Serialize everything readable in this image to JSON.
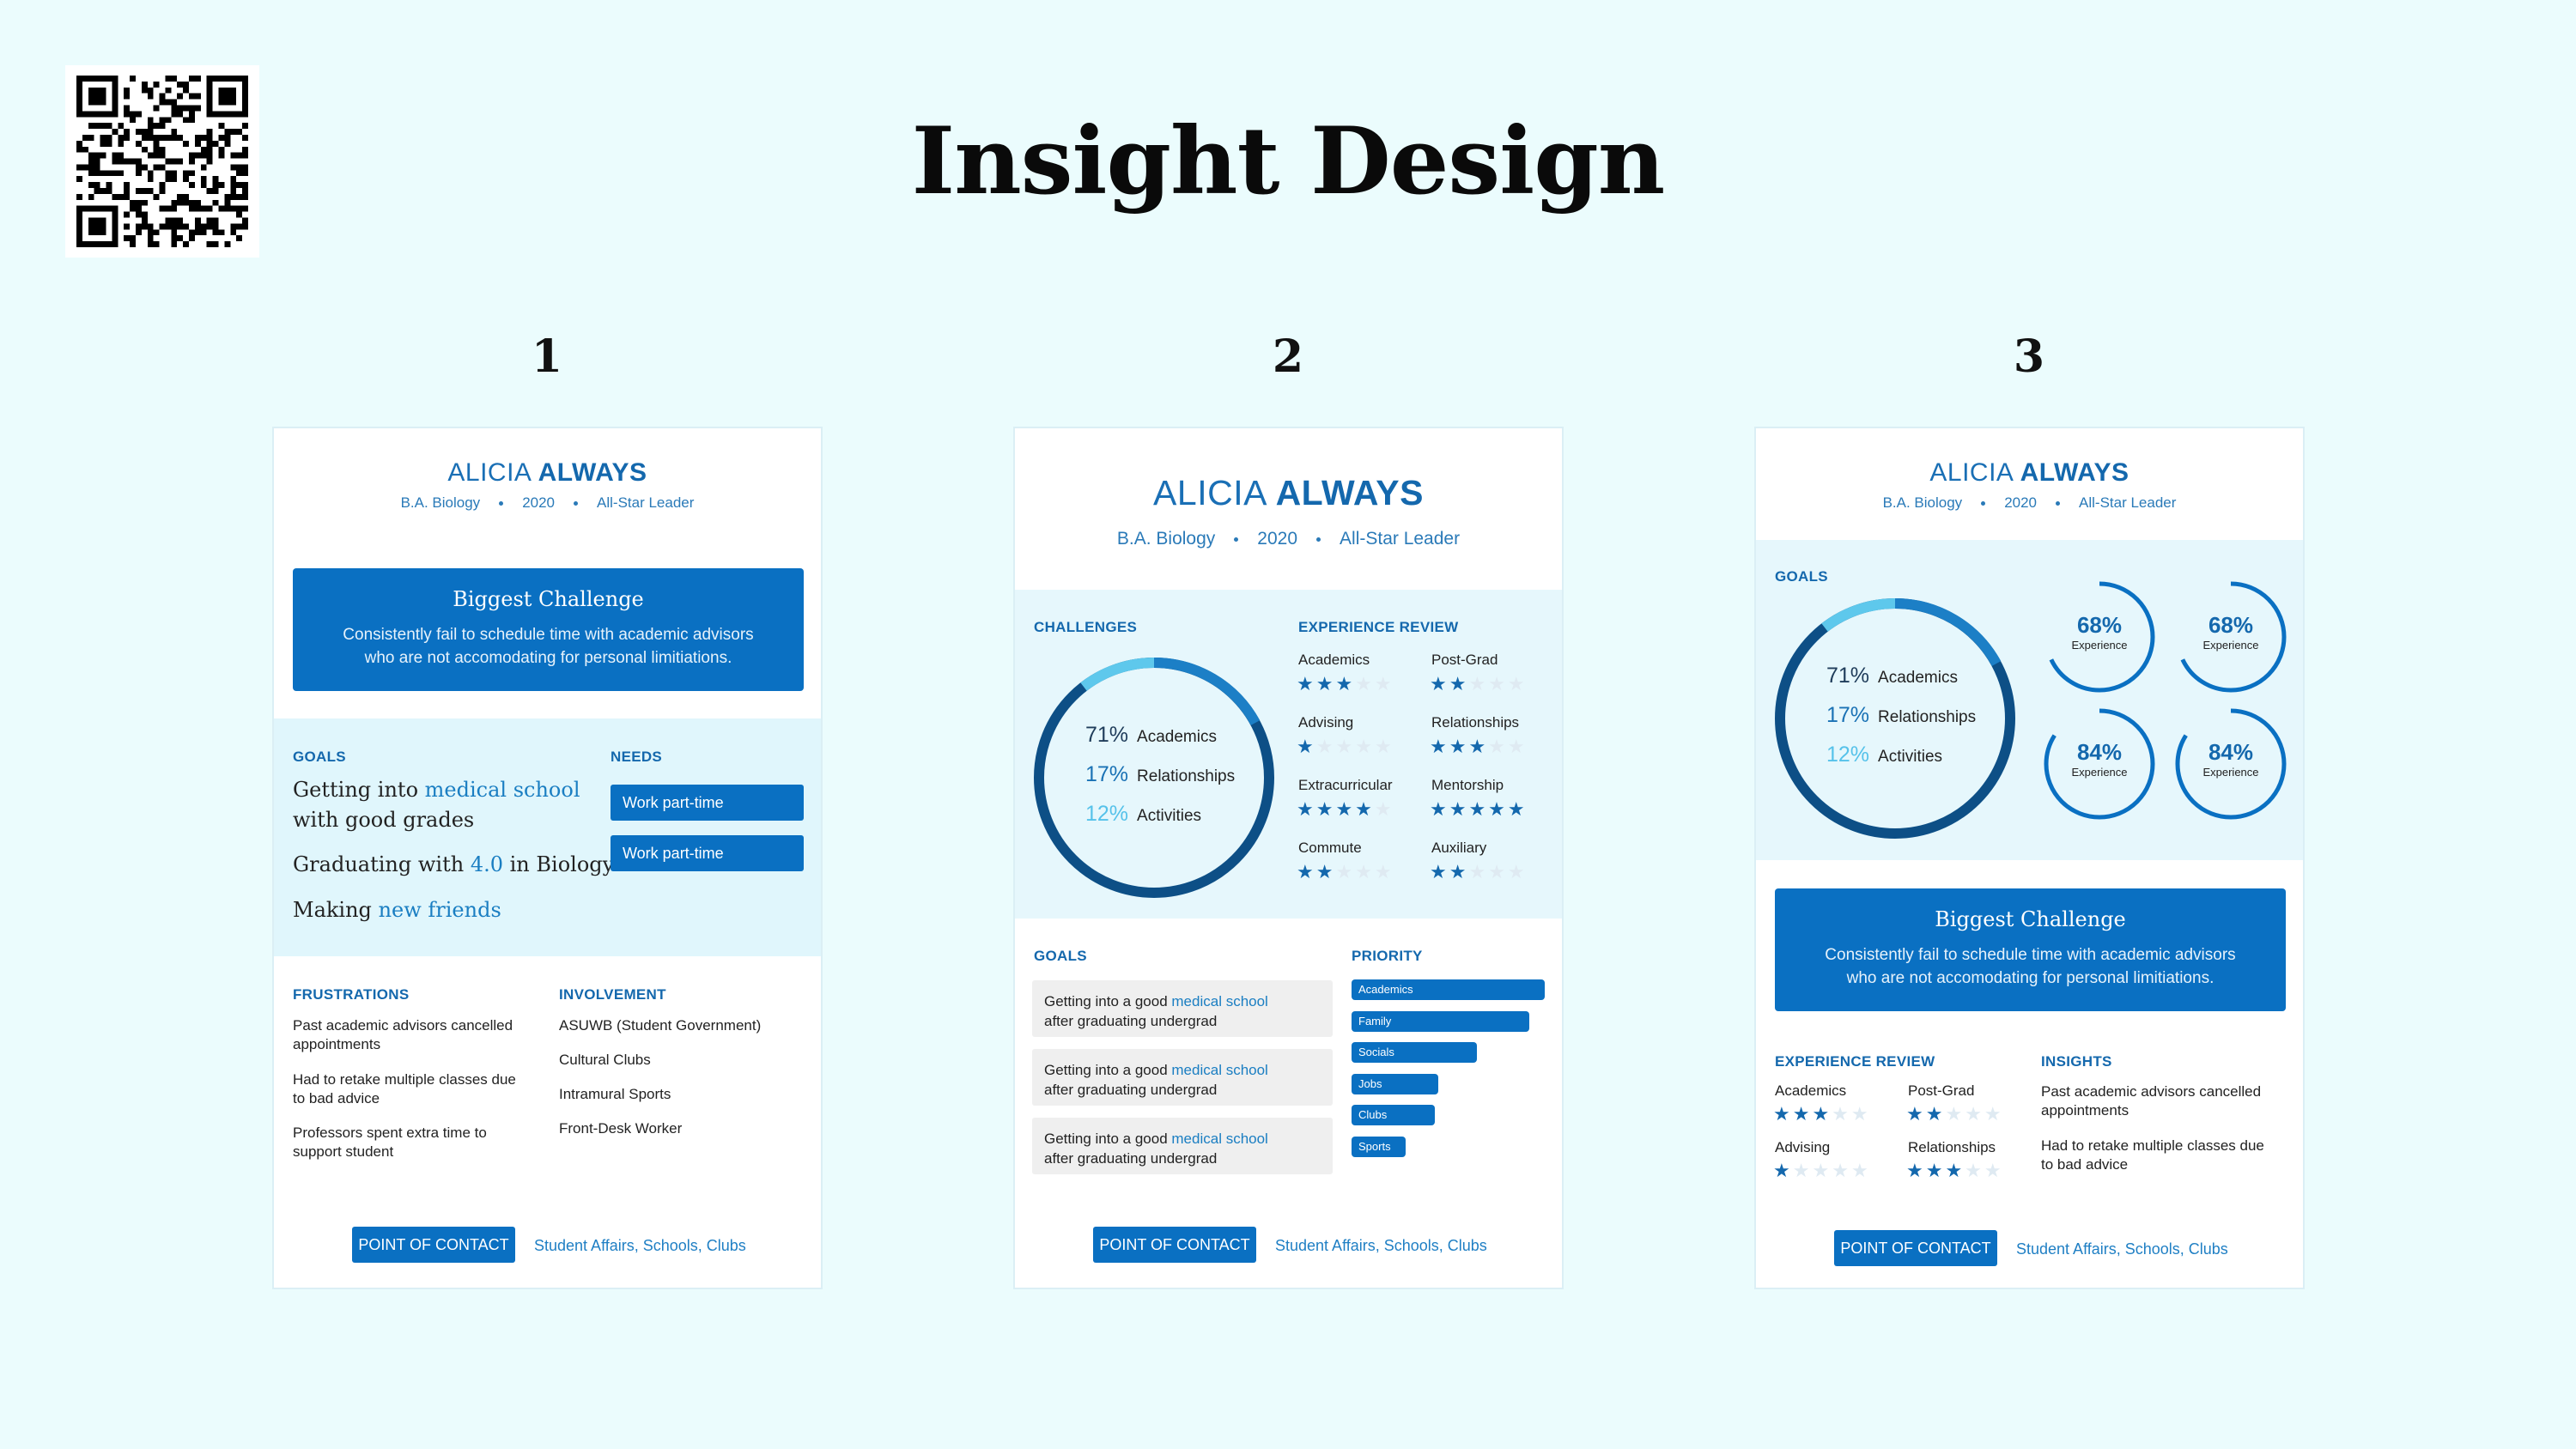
{
  "title": "Insight Design",
  "colors": {
    "background": "#ebfcfd",
    "accent": "#0a70c2",
    "light_panel": "#e0f6fc"
  },
  "numbers": [
    "1",
    "2",
    "3"
  ],
  "persona": {
    "first": "ALICIA",
    "last": "ALWAYS",
    "degree": "B.A. Biology",
    "year": "2020",
    "role": "All-Star Leader"
  },
  "card1": {
    "challenge_title": "Biggest Challenge",
    "challenge_l1": "Consistently fail to schedule time with academic advisors",
    "challenge_l2": "who are not accomodating for personal limitiations.",
    "goals_label": "GOALS",
    "goal1_a": "Getting into ",
    "goal1_hl": "medical school",
    "goal1_b": "with good grades",
    "goal2_a": "Graduating with ",
    "goal2_hl": "4.0",
    "goal2_b": " in Biology",
    "goal3_a": "Making ",
    "goal3_hl": "new friends",
    "needs_label": "NEEDS",
    "need1": "Work part-time",
    "need2": "Work part-time",
    "frustrations_label": "FRUSTRATIONS",
    "fr1_l1": "Past academic advisors cancelled",
    "fr1_l2": "appointments",
    "fr2_l1": "Had to retake multiple classes due",
    "fr2_l2": "to bad advice",
    "fr3_l1": "Professors spent extra time to",
    "fr3_l2": "support student",
    "involvement_label": "INVOLVEMENT",
    "inv1": "ASUWB (Student Government)",
    "inv2": "Cultural Clubs",
    "inv3": "Intramural Sports",
    "inv4": "Front-Desk Worker"
  },
  "card2": {
    "challenges_label": "CHALLENGES",
    "experience_label": "EXPERIENCE REVIEW",
    "donut": [
      {
        "pct": "71%",
        "label": "Academics",
        "value": 71
      },
      {
        "pct": "17%",
        "label": "Relationships",
        "value": 17
      },
      {
        "pct": "12%",
        "label": "Activities",
        "value": 12
      }
    ],
    "reviews": [
      {
        "label": "Academics",
        "stars": 3
      },
      {
        "label": "Post-Grad",
        "stars": 2
      },
      {
        "label": "Advising",
        "stars": 1
      },
      {
        "label": "Relationships",
        "stars": 3
      },
      {
        "label": "Extracurricular",
        "stars": 4
      },
      {
        "label": "Mentorship",
        "stars": 5
      },
      {
        "label": "Commute",
        "stars": 2
      },
      {
        "label": "Auxiliary",
        "stars": 2
      }
    ],
    "goals_label": "GOALS",
    "goal_a": "Getting into a good ",
    "goal_hl": "medical school",
    "goal_b": "after graduating undergrad",
    "priority_label": "PRIORITY",
    "priorities": [
      {
        "label": "Academics",
        "value": 100
      },
      {
        "label": "Family",
        "value": 92
      },
      {
        "label": "Socials",
        "value": 65
      },
      {
        "label": "Jobs",
        "value": 45
      },
      {
        "label": "Clubs",
        "value": 43
      },
      {
        "label": "Sports",
        "value": 28
      }
    ]
  },
  "card3": {
    "goals_label": "GOALS",
    "donut": [
      {
        "pct": "71%",
        "label": "Academics"
      },
      {
        "pct": "17%",
        "label": "Relationships"
      },
      {
        "pct": "12%",
        "label": "Activities"
      }
    ],
    "minis": [
      {
        "pct": "68%",
        "label": "Experience",
        "value": 68
      },
      {
        "pct": "68%",
        "label": "Experience",
        "value": 68
      },
      {
        "pct": "84%",
        "label": "Experience",
        "value": 84
      },
      {
        "pct": "84%",
        "label": "Experience",
        "value": 84
      }
    ],
    "challenge_title": "Biggest Challenge",
    "challenge_l1": "Consistently fail to schedule time with academic advisors",
    "challenge_l2": "who are not accomodating for personal limitiations.",
    "experience_label": "EXPERIENCE REVIEW",
    "reviews": [
      {
        "label": "Academics",
        "stars": 3
      },
      {
        "label": "Post-Grad",
        "stars": 2
      },
      {
        "label": "Advising",
        "stars": 1
      },
      {
        "label": "Relationships",
        "stars": 3
      }
    ],
    "insights_label": "INSIGHTS",
    "ins1_l1": "Past academic advisors cancelled",
    "ins1_l2": "appointments",
    "ins2_l1": "Had to retake multiple classes due",
    "ins2_l2": "to bad advice"
  },
  "contact": {
    "button": "POINT OF CONTACT",
    "link": "Student Affairs, Schools, Clubs"
  }
}
